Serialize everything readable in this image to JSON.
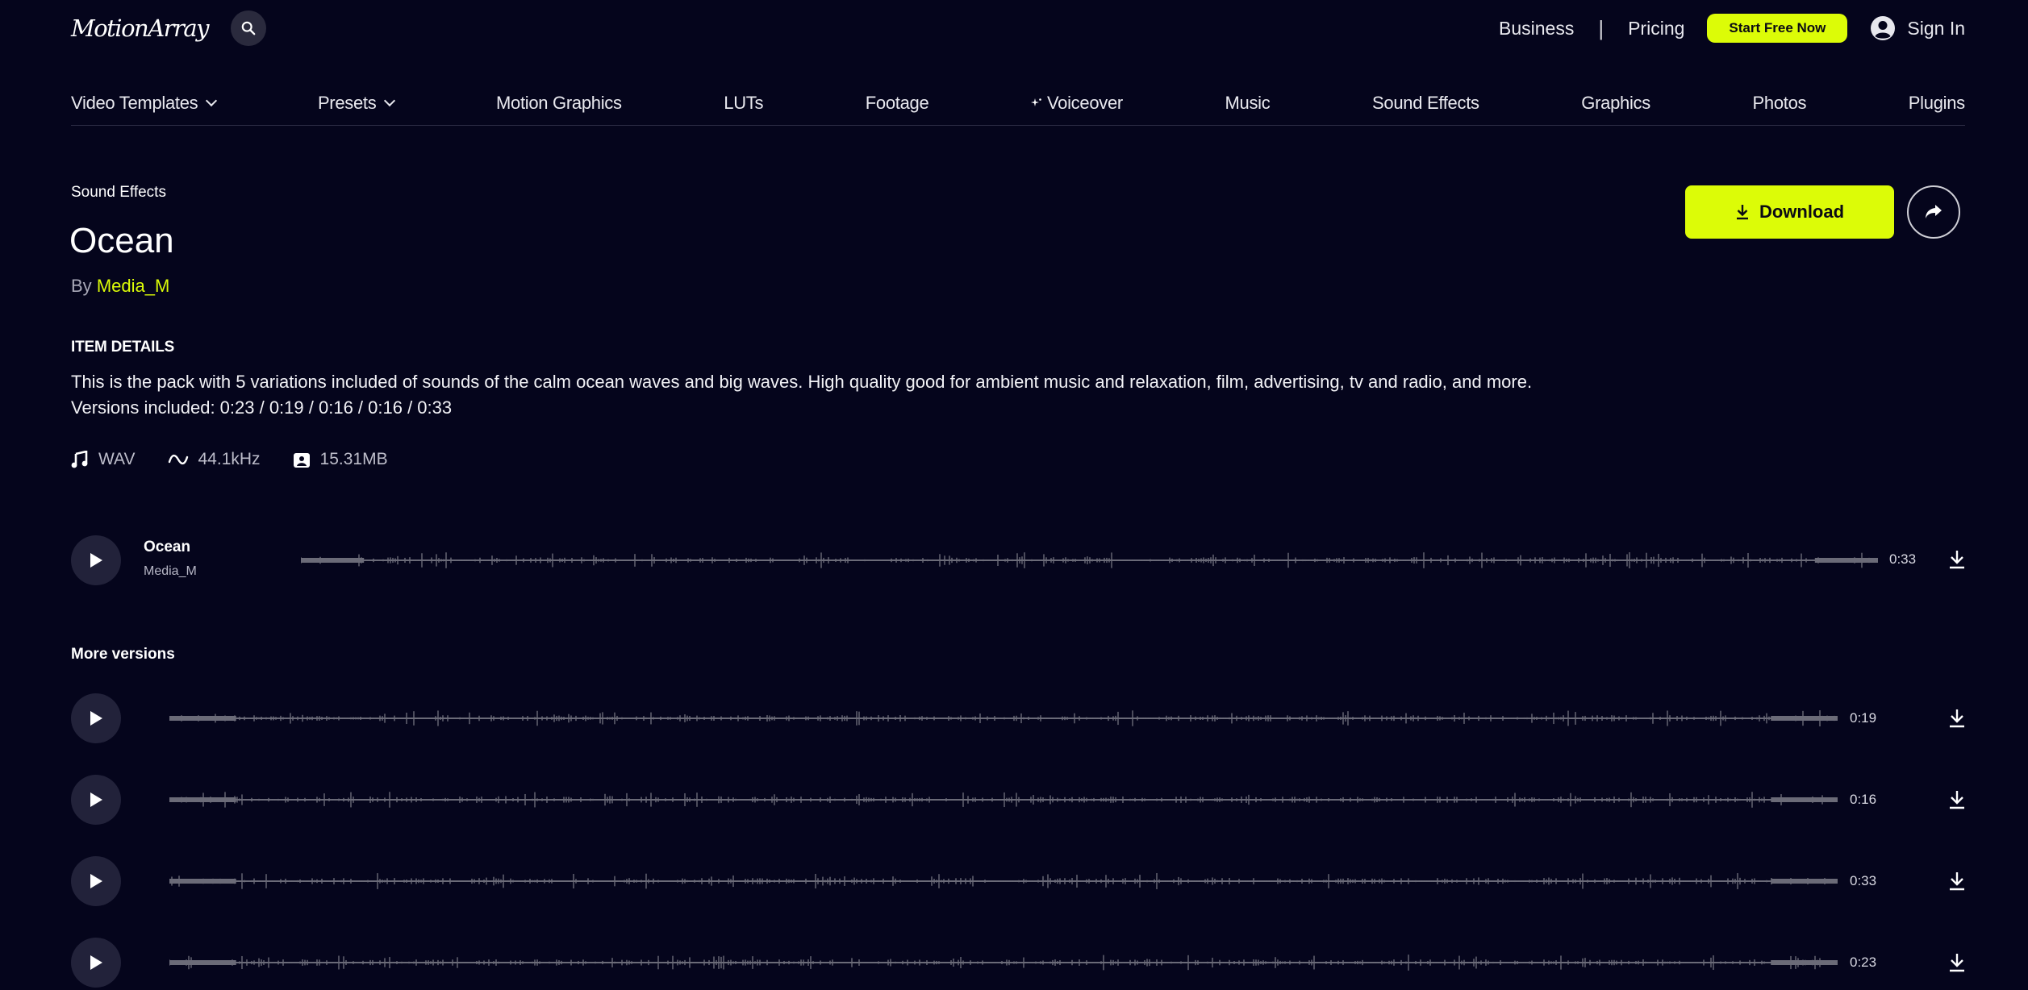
{
  "header": {
    "logo": "MotionArray",
    "business": "Business",
    "pricing": "Pricing",
    "start_free": "Start Free Now",
    "sign_in": "Sign In"
  },
  "nav": [
    {
      "label": "Video Templates",
      "dropdown": true
    },
    {
      "label": "Presets",
      "dropdown": true
    },
    {
      "label": "Motion Graphics",
      "dropdown": false
    },
    {
      "label": "LUTs",
      "dropdown": false
    },
    {
      "label": "Footage",
      "dropdown": false
    },
    {
      "label": "Voiceover",
      "dropdown": false,
      "icon": "sparkle-icon"
    },
    {
      "label": "Music",
      "dropdown": false
    },
    {
      "label": "Sound Effects",
      "dropdown": false
    },
    {
      "label": "Graphics",
      "dropdown": false
    },
    {
      "label": "Photos",
      "dropdown": false
    },
    {
      "label": "Plugins",
      "dropdown": false
    }
  ],
  "item": {
    "category": "Sound Effects",
    "title": "Ocean",
    "by_prefix": "By",
    "author": "Media_M",
    "download_label": "Download",
    "details_heading": "ITEM DETAILS",
    "description_line1": "This is the pack with 5 variations included of sounds of the calm ocean waves and big waves. High quality good for ambient music and relaxation, film, advertising, tv and radio, and more.",
    "description_line2": "Versions included: 0:23 / 0:19 / 0:16 / 0:16 / 0:33",
    "format": "WAV",
    "sample_rate": "44.1kHz",
    "file_size": "15.31MB"
  },
  "main_track": {
    "title": "Ocean",
    "artist": "Media_M",
    "duration": "0:33"
  },
  "more_versions": {
    "heading": "More versions",
    "items": [
      {
        "duration": "0:19"
      },
      {
        "duration": "0:16"
      },
      {
        "duration": "0:33"
      },
      {
        "duration": "0:23"
      }
    ]
  },
  "colors": {
    "background": "#05051c",
    "accent": "#dcfc07",
    "waveform": "#6b6b78"
  }
}
